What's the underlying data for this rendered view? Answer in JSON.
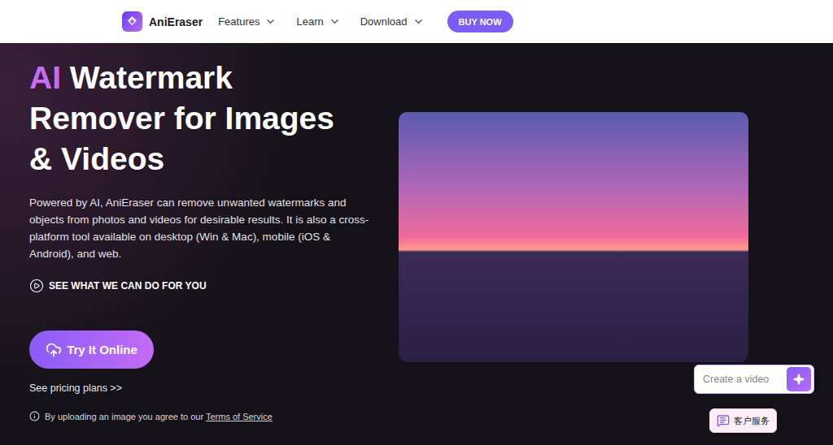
{
  "nav": {
    "brand": "AniEraser",
    "menus": [
      {
        "label": "Features"
      },
      {
        "label": "Learn"
      },
      {
        "label": "Download"
      }
    ],
    "cta": "BUY NOW"
  },
  "hero": {
    "title_highlight": "AI",
    "title_lines": [
      "Watermark",
      "Remover for Images",
      "& Videos"
    ],
    "description": "Powered by AI, AniEraser can remove unwanted watermarks and objects from photos and videos for desirable results. It is also a cross-platform tool available on desktop (Win & Mac), mobile (iOS & Android), and web.",
    "see_what": "SEE WHAT WE CAN DO FOR YOU",
    "try_button": "Try It Online",
    "pricing_link": "See pricing plans >>",
    "terms_prefix": "By uploading an image you agree to our ",
    "terms_link": "Terms of Service"
  },
  "assistant": {
    "placeholder": "Create a video"
  },
  "support": {
    "label": "客户服务"
  }
}
